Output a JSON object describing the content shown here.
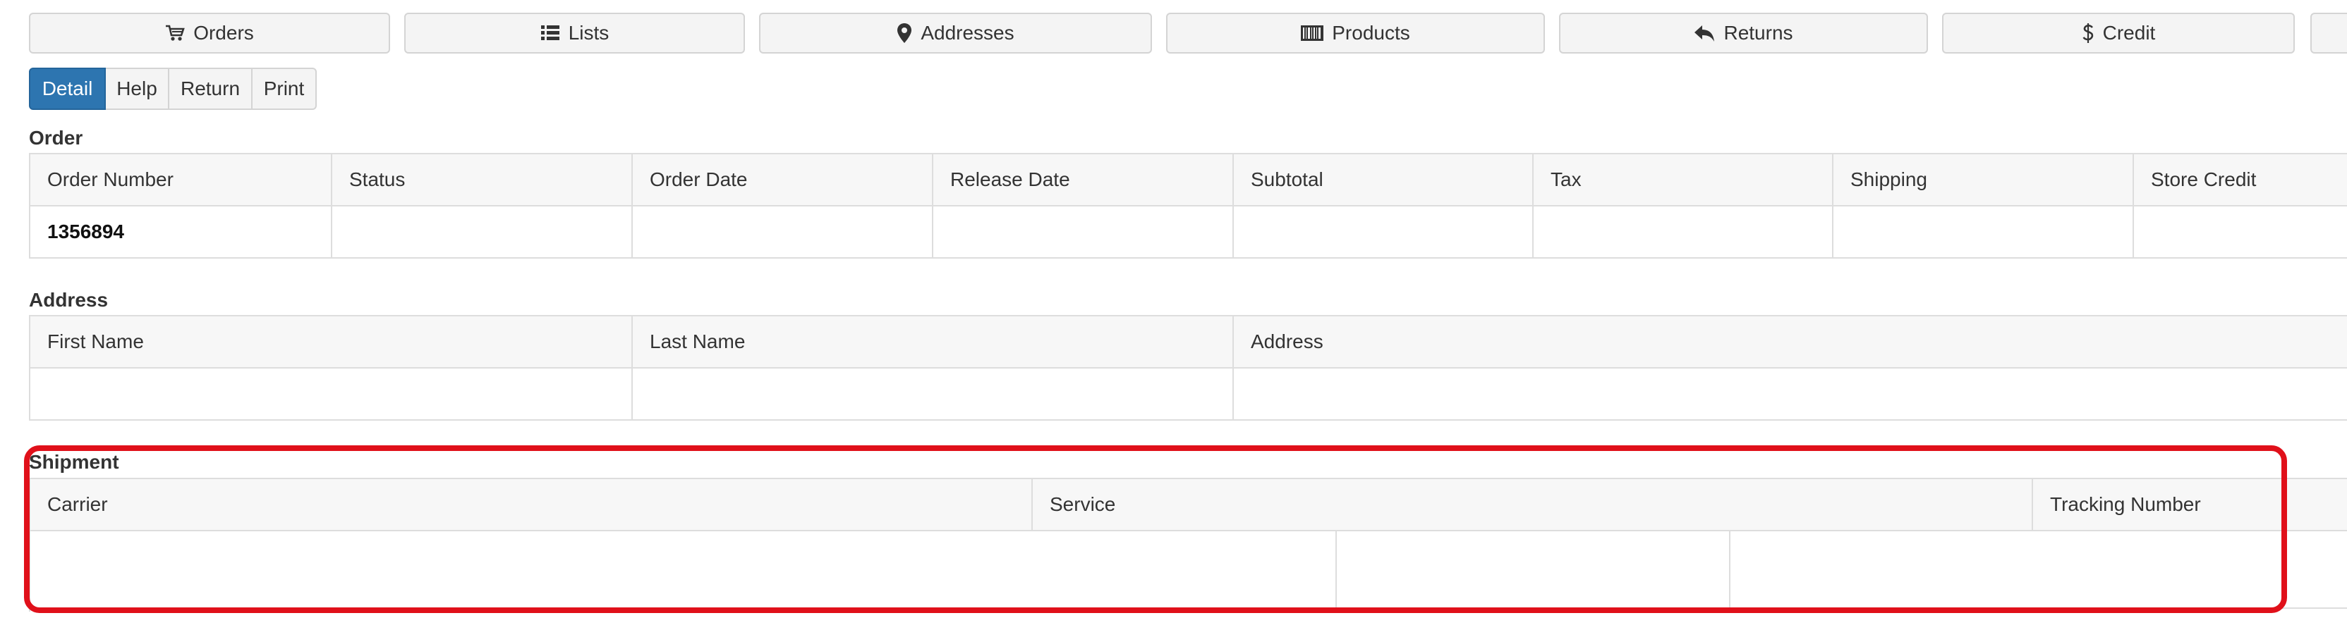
{
  "nav": {
    "orders": {
      "label": "Orders",
      "icon": "cart-icon"
    },
    "lists": {
      "label": "Lists",
      "icon": "list-icon"
    },
    "addresses": {
      "label": "Addresses",
      "icon": "map-marker-icon"
    },
    "products": {
      "label": "Products",
      "icon": "barcode-icon"
    },
    "returns": {
      "label": "Returns",
      "icon": "reply-arrow-icon"
    },
    "credit": {
      "label": "Credit",
      "icon": "dollar-icon"
    }
  },
  "tabs": {
    "detail": "Detail",
    "help": "Help",
    "return": "Return",
    "print": "Print",
    "active": "Detail",
    "active_color": "#2d75b0"
  },
  "order": {
    "title": "Order",
    "columns": [
      "Order Number",
      "Status",
      "Order Date",
      "Release Date",
      "Subtotal",
      "Tax",
      "Shipping",
      "Store Credit"
    ],
    "row": [
      "1356894",
      "",
      "",
      "",
      "",
      "",
      "",
      ""
    ]
  },
  "address": {
    "title": "Address",
    "columns": [
      "First Name",
      "Last Name",
      "Address"
    ],
    "row": [
      "",
      "",
      ""
    ]
  },
  "shipment": {
    "title": "Shipment",
    "columns": [
      "Carrier",
      "Service",
      "Tracking Number"
    ],
    "highlight_color": "#e0101a"
  }
}
